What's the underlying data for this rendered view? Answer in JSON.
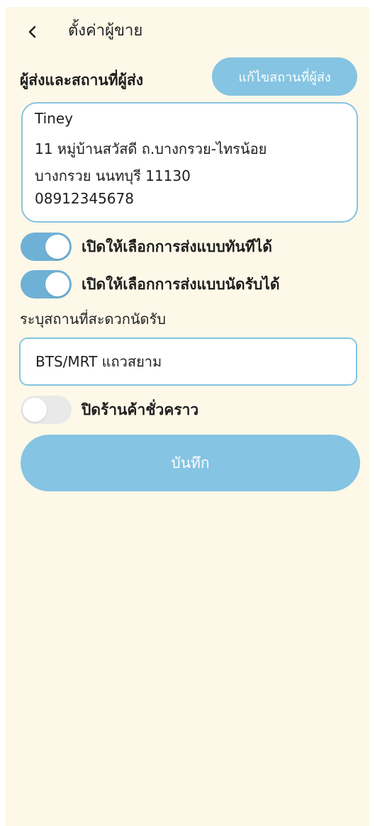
{
  "header": {
    "back_icon": "chevron-left-icon",
    "title": "ตั้งค่าผู้ขาย"
  },
  "sender_section": {
    "title": "ผู้ส่งและสถานที่ผู้ส่ง",
    "edit_button_label": "แก้ไขสถานที่ผู้ส่ง",
    "address_lines": [
      "Tiney",
      "11 หมู่บ้านสวัสดี ถ.บางกรวย-ไทรน้อย",
      "บางกรวย นนทบุรี 11130",
      "08912345678"
    ]
  },
  "toggles": {
    "instant_delivery": {
      "label": "เปิดให้เลือกการส่งแบบทันทีได้",
      "on": true
    },
    "pickup_delivery": {
      "label": "เปิดให้เลือกการส่งแบบนัดรับได้",
      "on": true
    },
    "temp_close": {
      "label": "ปิดร้านค้าชั่วคราว",
      "on": false
    }
  },
  "pickup": {
    "label": "ระบุสถานที่สะดวกนัดรับ",
    "value": "BTS/MRT แถวสยาม"
  },
  "save_button_label": "บันทึก",
  "colors": {
    "background": "#fdf8e8",
    "accent": "#85c4e2",
    "toggle_on": "#6fb0d6",
    "toggle_off": "#e9e9e9"
  }
}
